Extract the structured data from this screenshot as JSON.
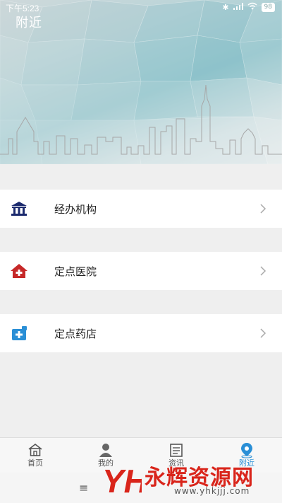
{
  "status_bar": {
    "time": "下午5:23",
    "battery": "98"
  },
  "header": {
    "title": "附近"
  },
  "menu": [
    {
      "label": "经办机构",
      "icon": "bank-building-icon",
      "color": "#1b2a6e"
    },
    {
      "label": "定点医院",
      "icon": "hospital-icon",
      "color": "#c62828"
    },
    {
      "label": "定点药店",
      "icon": "pharmacy-icon",
      "color": "#2a8fd6"
    }
  ],
  "tabbar": [
    {
      "label": "首页",
      "icon": "home-icon"
    },
    {
      "label": "我的",
      "icon": "user-icon"
    },
    {
      "label": "资讯",
      "icon": "news-icon"
    },
    {
      "label": "附近",
      "icon": "location-pin-icon",
      "active": true
    }
  ],
  "navbar": {
    "menu_glyph": "≡"
  },
  "watermark": {
    "logo_text": "YH",
    "title": "永辉资源网",
    "url": "www.yhkjjj.com"
  },
  "colors": {
    "accent": "#2a8fd6",
    "background": "#efefef"
  }
}
